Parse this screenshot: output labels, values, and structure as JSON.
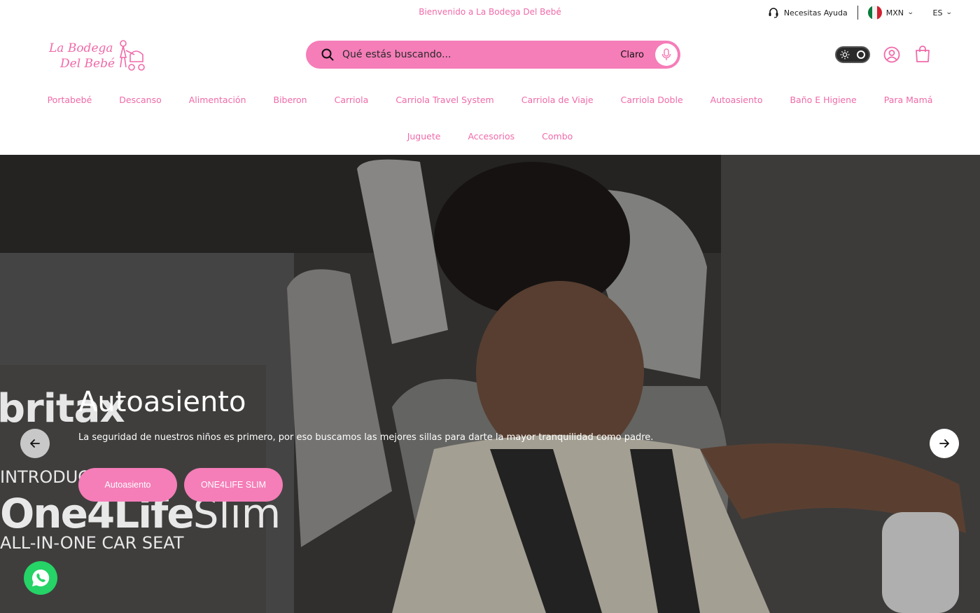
{
  "topbar": {
    "welcome": "Bienvenido a La Bodega Del Bebé",
    "help_label": "Necesitas Ayuda",
    "currency": "MXN",
    "language": "ES"
  },
  "logo": {
    "line1": "La Bodega",
    "line2": "Del Bebé"
  },
  "search": {
    "placeholder": "Qué estás buscando...",
    "mode_label": "Claro"
  },
  "nav": {
    "row1": [
      "Portabebé",
      "Descanso",
      "Alimentación",
      "Biberon",
      "Carriola",
      "Carriola Travel System",
      "Carriola de Viaje",
      "Carriola Doble",
      "Autoasiento",
      "Baño E Higiene",
      "Para Mamá"
    ],
    "row2": [
      "Juguete",
      "Accesorios",
      "Combo"
    ]
  },
  "hero": {
    "title": "Autoasiento",
    "description": "La seguridad de nuestros niños es primero, por eso buscamos las mejores sillas para darte la mayor tranquilidad como padre.",
    "button_primary": "Autoasiento",
    "button_secondary": "ONE4LIFE SLIM",
    "brand": "britax",
    "intro_text": "INTRODUCING",
    "model_name": "One4Life",
    "model_suffix": "Slim",
    "model_sub": "ALL-IN-ONE CAR SEAT"
  },
  "colors": {
    "accent": "#f57db8",
    "accent_text": "#f06aa9",
    "whatsapp": "#25d366"
  }
}
